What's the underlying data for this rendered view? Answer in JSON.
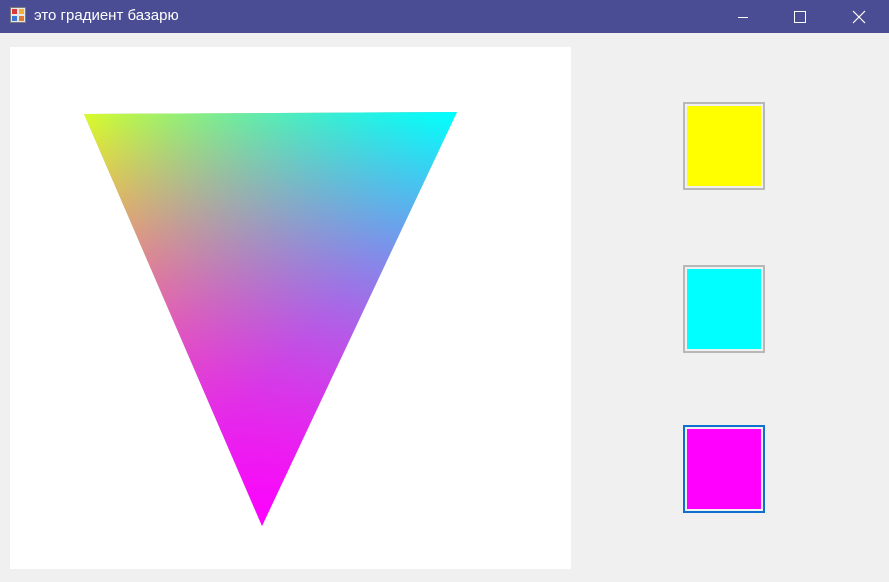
{
  "window": {
    "title": "это градиент базарю",
    "title_bar_color": "#4a4c94",
    "icon": "app-window-icon",
    "controls": [
      "minimize-icon",
      "maximize-icon",
      "close-icon"
    ]
  },
  "gradient_triangle": {
    "vertex_colors": {
      "top_left": "#ffff00",
      "top_right": "#00ffff",
      "bottom": "#ff00ff"
    }
  },
  "color_buttons": [
    {
      "color": "#ffff00",
      "selected": false
    },
    {
      "color": "#00ffff",
      "selected": false
    },
    {
      "color": "#ff00ff",
      "selected": true
    }
  ]
}
